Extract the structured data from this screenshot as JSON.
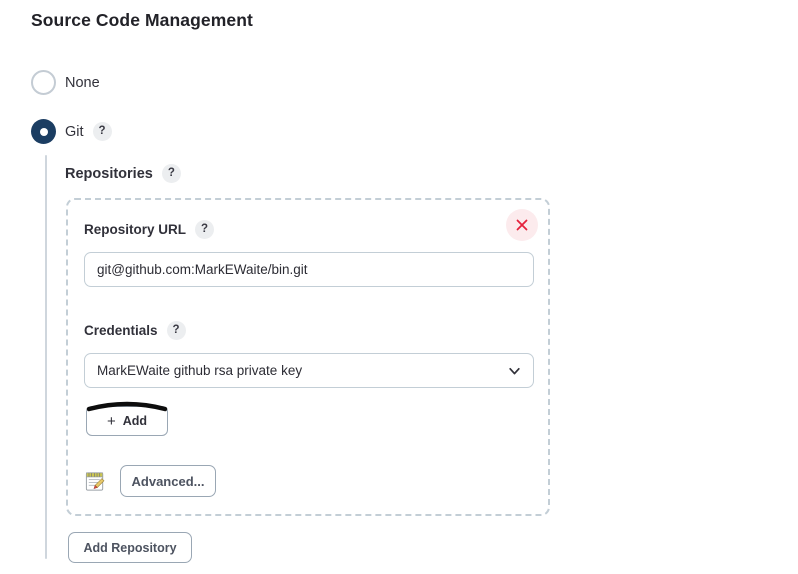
{
  "section": {
    "title": "Source Code Management"
  },
  "scm_options": [
    {
      "label": "None",
      "selected": false,
      "has_help": false
    },
    {
      "label": "Git",
      "selected": true,
      "has_help": true
    }
  ],
  "repositories": {
    "heading": "Repositories",
    "help_glyph": "?",
    "repository": {
      "url_label": "Repository URL",
      "url_value": "git@github.com:MarkEWaite/bin.git",
      "url_placeholder": "",
      "credentials_label": "Credentials",
      "credentials_selected": "MarkEWaite github rsa private key",
      "add_credentials_label": "Add",
      "add_credentials_plus": "+",
      "advanced_label": "Advanced...",
      "advanced_icon": "notepad-pencil-icon",
      "delete_icon": "close-x-icon"
    },
    "add_repository_label": "Add Repository"
  },
  "colors": {
    "radio_selected": "#1b3d62",
    "radio_unselected_border": "#c4ccd4",
    "dashed_border": "#c3ced6",
    "input_border": "#c3ced6",
    "help_badge_bg": "#eceef0",
    "delete_bg": "#fcebed",
    "delete_x": "#e5213c",
    "button_border": "#9aa7b4",
    "button_text": "#4d5360",
    "indent_line": "#cfd6dd",
    "text_primary": "#31313a",
    "annotation": "#0d0d0d"
  }
}
